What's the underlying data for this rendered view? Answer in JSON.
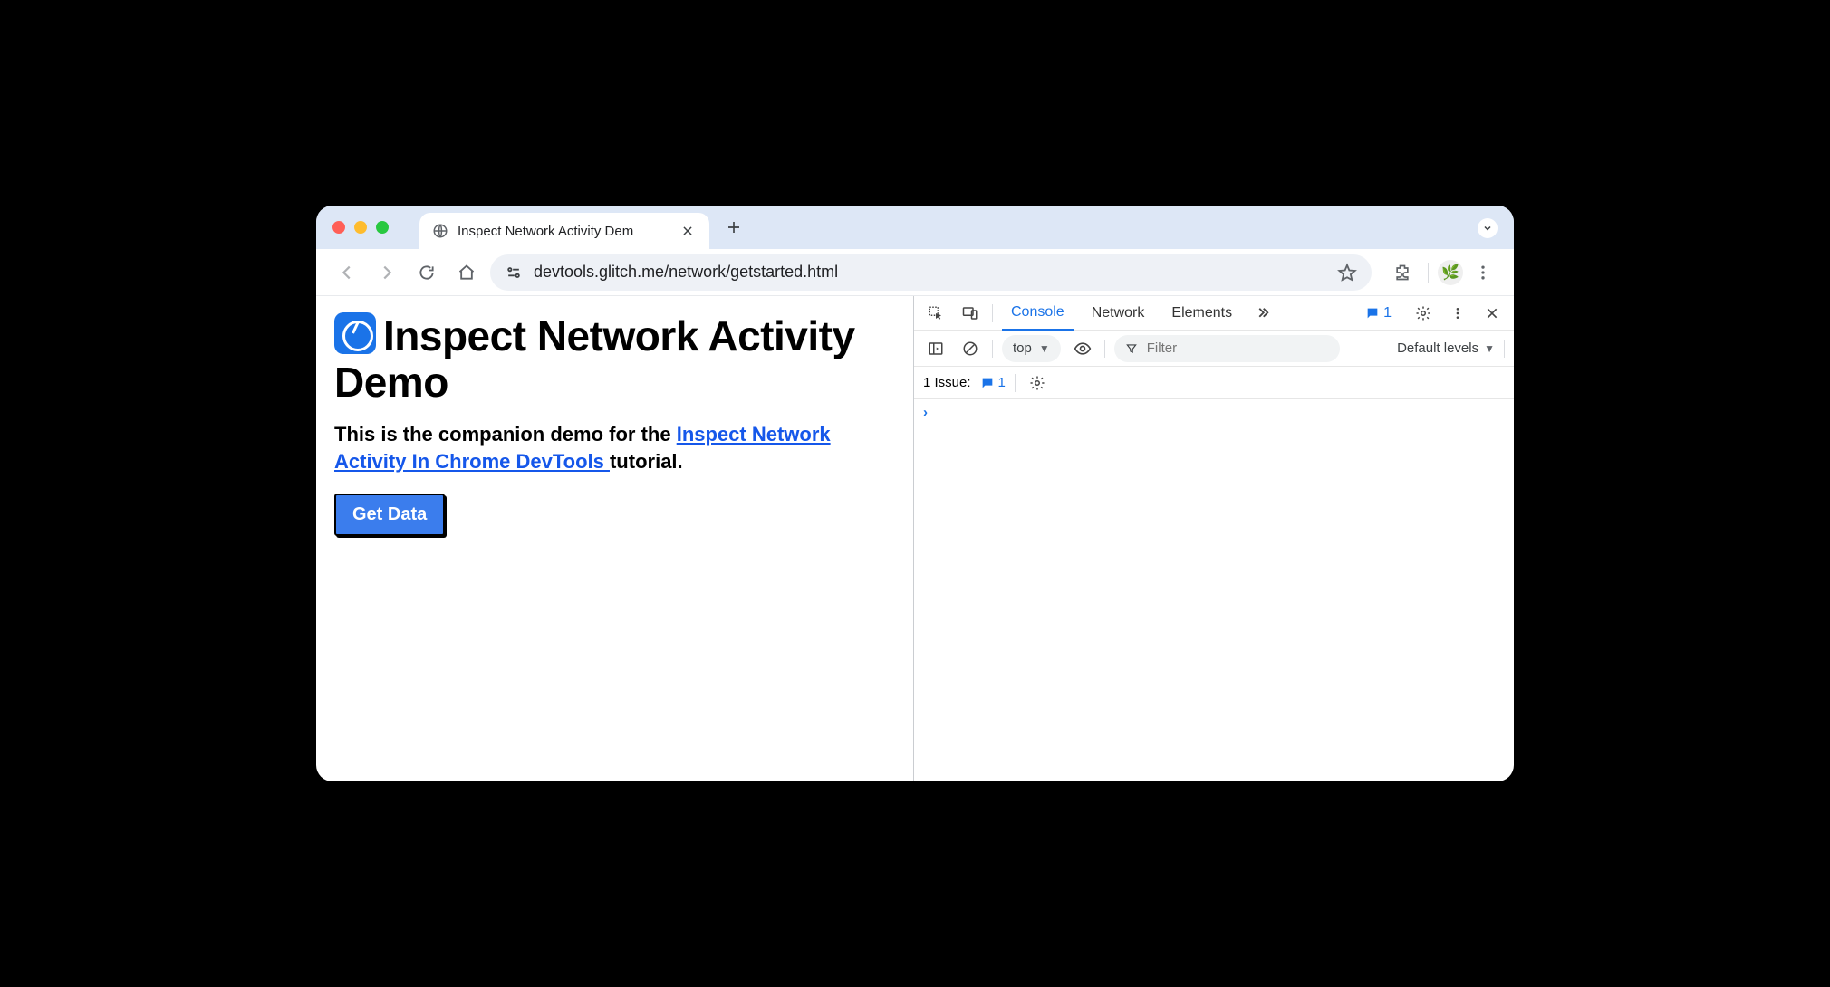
{
  "browser": {
    "tab_title": "Inspect Network Activity Dem",
    "url": "devtools.glitch.me/network/getstarted.html"
  },
  "page": {
    "heading": "Inspect Network Activity Demo",
    "desc_prefix": "This is the companion demo for the ",
    "link_text": "Inspect Network Activity In Chrome DevTools ",
    "desc_suffix": "tutorial.",
    "button_label": "Get Data"
  },
  "devtools": {
    "tabs": {
      "console": "Console",
      "network": "Network",
      "elements": "Elements"
    },
    "badge_count": "1",
    "context": "top",
    "filter_placeholder": "Filter",
    "levels_label": "Default levels",
    "issue_label": "1 Issue:",
    "issue_count": "1"
  }
}
